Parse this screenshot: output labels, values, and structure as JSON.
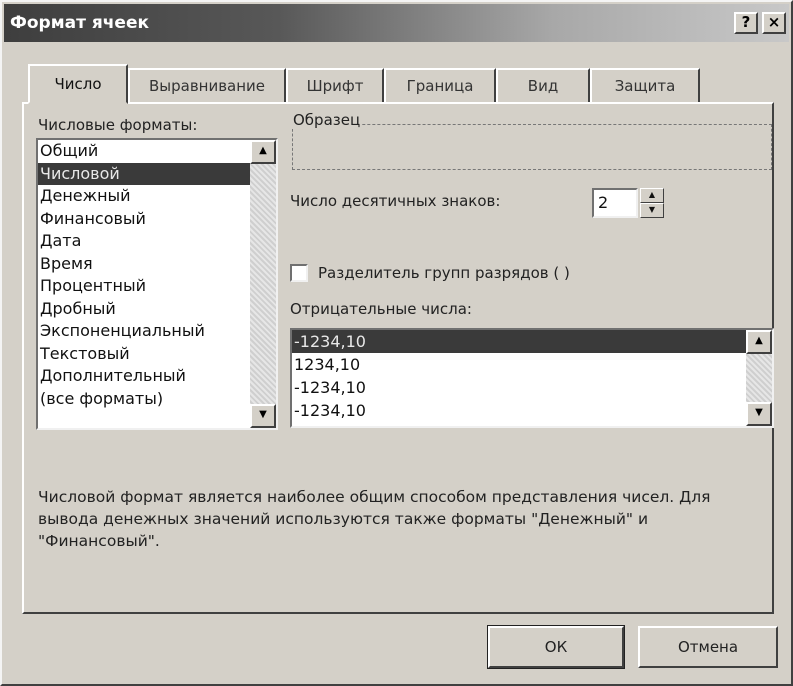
{
  "window": {
    "title": "Формат ячеек",
    "help_label": "?",
    "close_label": "×"
  },
  "tabs": [
    "Число",
    "Выравнивание",
    "Шрифт",
    "Граница",
    "Вид",
    "Защита"
  ],
  "active_tab": "Число",
  "formats": {
    "label": "Числовые форматы:",
    "items": [
      "Общий",
      "Числовой",
      "Денежный",
      "Финансовый",
      "Дата",
      "Время",
      "Процентный",
      "Дробный",
      "Экспоненциальный",
      "Текстовый",
      "Дополнительный",
      "(все форматы)"
    ],
    "selected": "Числовой"
  },
  "sample": {
    "label": "Образец",
    "value": ""
  },
  "decimals": {
    "label": "Число десятичных знаков:",
    "value": "2"
  },
  "separator": {
    "label": "Разделитель групп разрядов ( )",
    "checked": false
  },
  "negative": {
    "label": "Отрицательные числа:",
    "items": [
      "-1234,10",
      "1234,10",
      "-1234,10",
      "-1234,10"
    ],
    "selected_index": 0
  },
  "description": "Числовой формат является наиболее общим способом представления чисел. Для вывода денежных значений используются также форматы \"Денежный\" и \"Финансовый\".",
  "buttons": {
    "ok": "ОК",
    "cancel": "Отмена"
  }
}
